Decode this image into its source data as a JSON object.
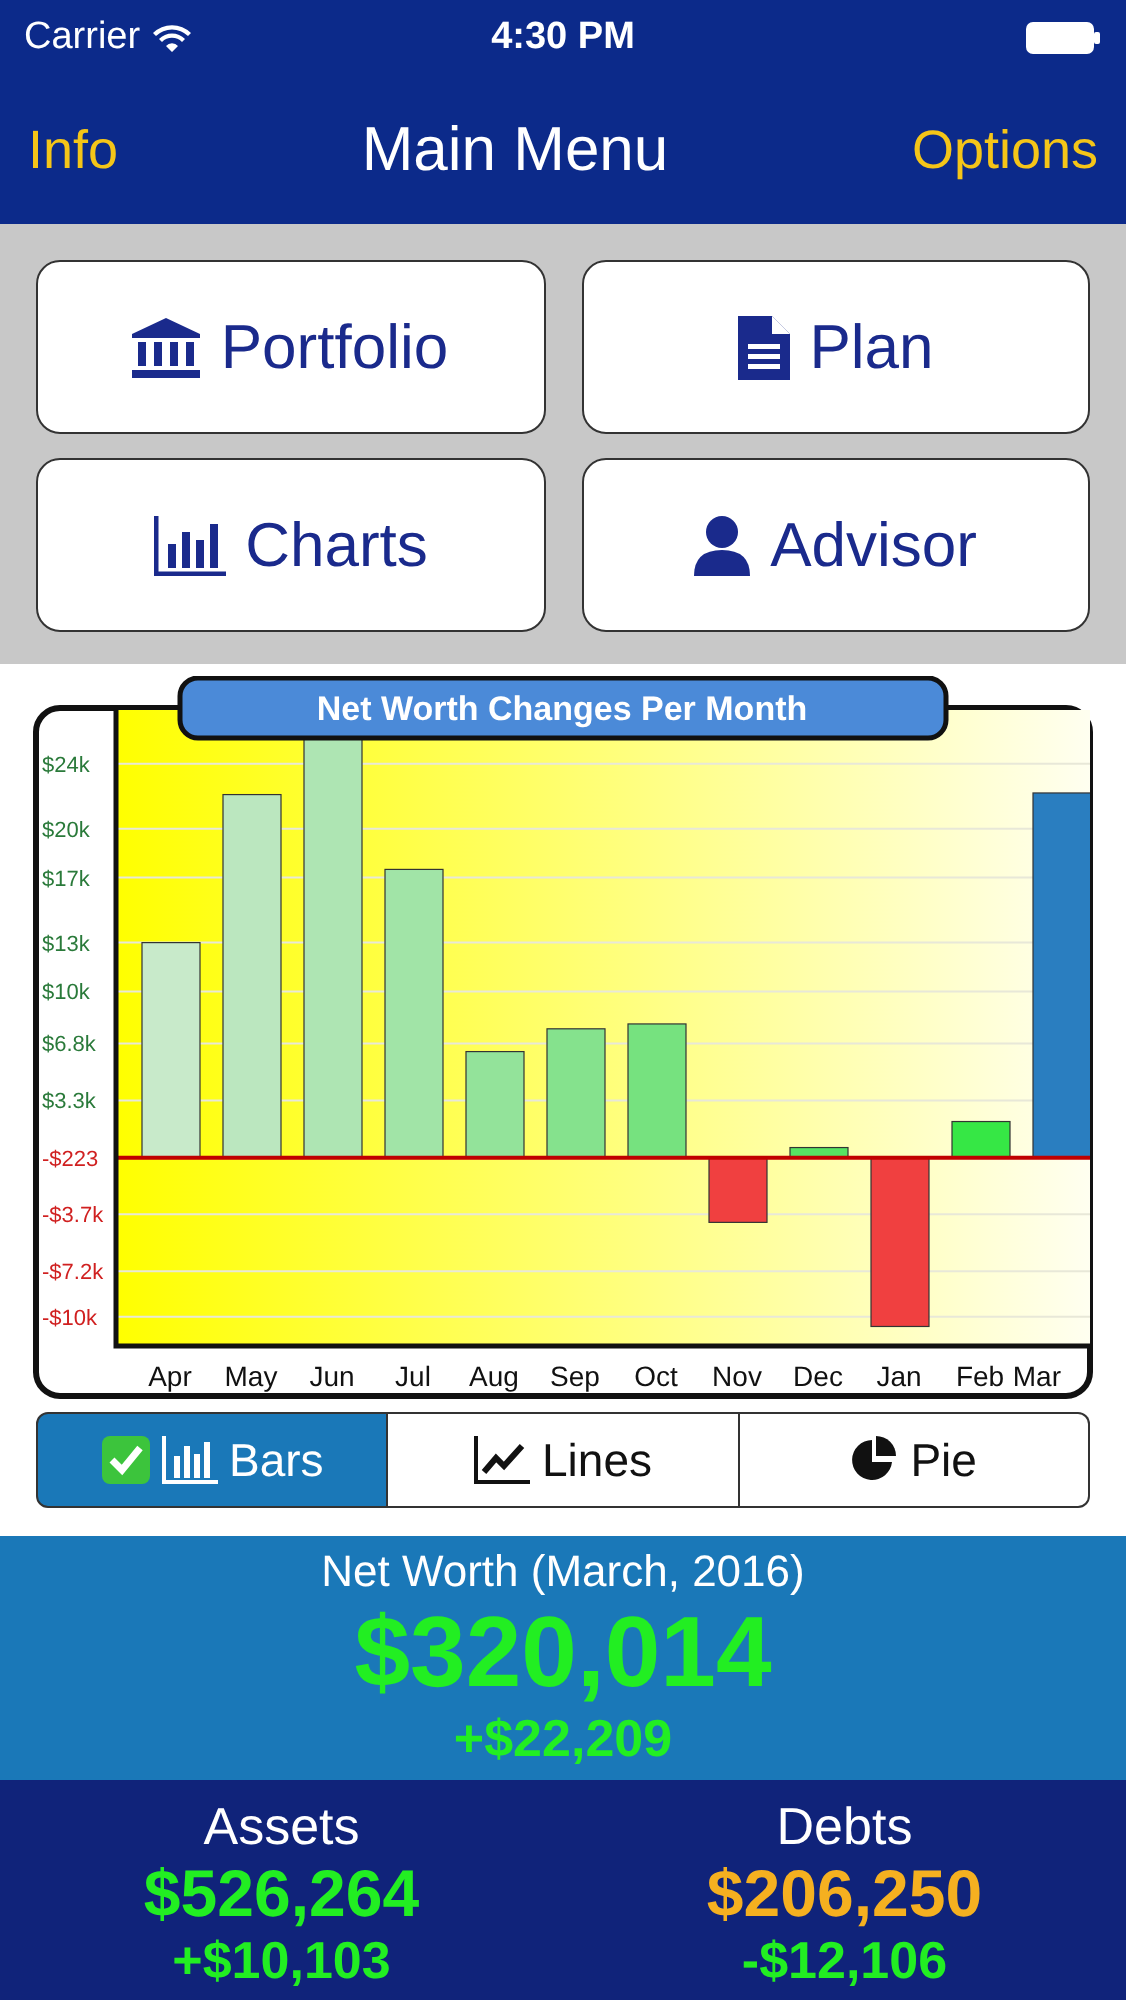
{
  "status_bar": {
    "carrier": "Carrier",
    "time": "4:30 PM"
  },
  "nav_bar": {
    "left": "Info",
    "title": "Main Menu",
    "right": "Options"
  },
  "menu_buttons": [
    {
      "label": "Portfolio",
      "kind": "bank"
    },
    {
      "label": "Plan",
      "kind": "document"
    },
    {
      "label": "Charts",
      "kind": "chart"
    },
    {
      "label": "Advisor",
      "kind": "person"
    }
  ],
  "chart": {
    "chart_data": {
      "type": "bar",
      "title": "Net Worth Changes Per Month",
      "categories": [
        "Apr",
        "May",
        "Jun",
        "Jul",
        "Aug",
        "Sep",
        "Oct",
        "Nov",
        "Dec",
        "Jan",
        "Feb",
        "Mar"
      ],
      "values": [
        13000,
        22100,
        25800,
        17500,
        6300,
        7700,
        8000,
        -4200,
        400,
        -10600,
        2000,
        22200
      ],
      "ylim": [
        -11800,
        27300
      ],
      "grid": true,
      "ref_lines": [
        {
          "axis": "y",
          "value": -223,
          "color": "#c00000"
        }
      ],
      "yticks": [
        {
          "value": 24000,
          "label": "$24k"
        },
        {
          "value": 20000,
          "label": "$20k"
        },
        {
          "value": 17000,
          "label": "$17k"
        },
        {
          "value": 13000,
          "label": "$13k"
        },
        {
          "value": 10000,
          "label": "$10k"
        },
        {
          "value": 6800,
          "label": "$6.8k"
        },
        {
          "value": 3300,
          "label": "$3.3k"
        },
        {
          "value": -223,
          "label": "-$223"
        },
        {
          "value": -3700,
          "label": "-$3.7k"
        },
        {
          "value": -7200,
          "label": "-$7.2k"
        },
        {
          "value": -10000,
          "label": "-$10k"
        }
      ]
    }
  },
  "chart_types": [
    {
      "label": "Bars",
      "kind": "bars",
      "selected": true
    },
    {
      "label": "Lines",
      "kind": "lines",
      "selected": false
    },
    {
      "label": "Pie",
      "kind": "pie",
      "selected": false
    }
  ],
  "net_worth": {
    "label": "Net Worth (March, 2016)",
    "value": "$320,014",
    "change": "+$22,209"
  },
  "totals": [
    {
      "label": "Assets",
      "value": "$526,264",
      "change": "+$10,103",
      "color": "#22ee22"
    },
    {
      "label": "Debts",
      "value": "$206,250",
      "change": "-$12,106",
      "color": "#f5b020"
    }
  ]
}
